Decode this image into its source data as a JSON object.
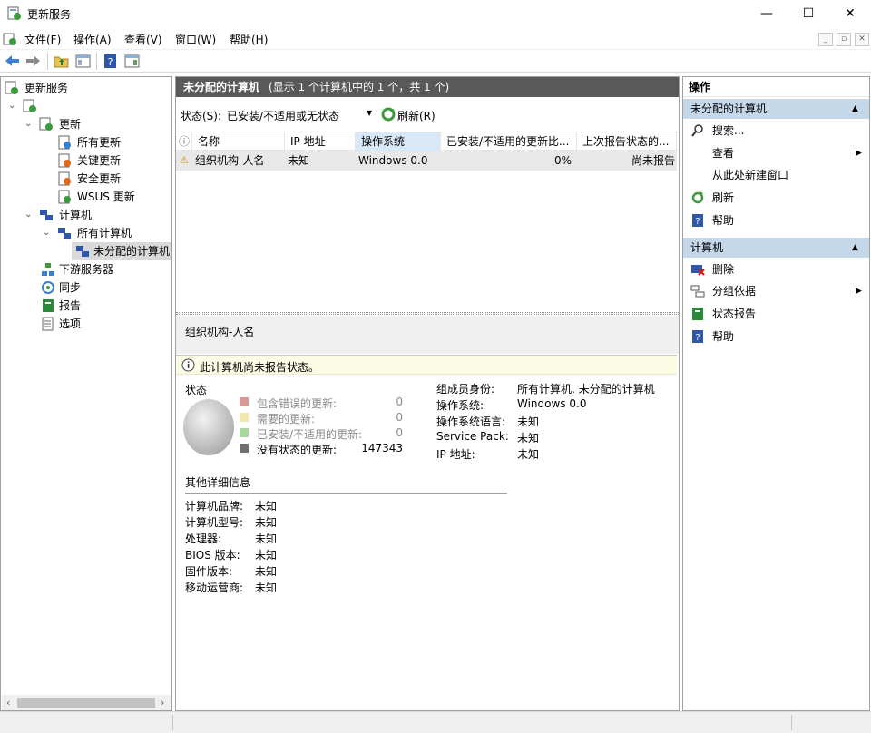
{
  "window": {
    "title": "更新服务",
    "minimize": "—",
    "maximize": "☐",
    "close": "✕"
  },
  "menu": [
    "文件(F)",
    "操作(A)",
    "查看(V)",
    "窗口(W)",
    "帮助(H)"
  ],
  "mdi": {
    "min": "_",
    "restore": "▫",
    "close": "✕"
  },
  "tree": {
    "root": "更新服务",
    "updates": "更新",
    "all_updates": "所有更新",
    "critical_updates": "关键更新",
    "security_updates": "安全更新",
    "wsus_updates": "WSUS 更新",
    "computers": "计算机",
    "all_computers": "所有计算机",
    "unassigned": "未分配的计算机",
    "downstream": "下游服务器",
    "sync": "同步",
    "reports": "报告",
    "options": "选项"
  },
  "middle": {
    "header": "未分配的计算机",
    "header_sub": "(显示 1 个计算机中的 1 个，共 1 个)",
    "filter_label": "状态(S):",
    "filter_value": "已安装/不适用或无状态",
    "refresh": "刷新(R)",
    "columns": [
      "名称",
      "IP 地址",
      "操作系统",
      "已安装/不适用的更新比...",
      "上次报告状态的..."
    ],
    "row": {
      "name": "组织机构-人名",
      "ip": "未知",
      "os": "Windows 0.0",
      "percent": "0%",
      "last_report": "尚未报告"
    },
    "detail_title": "组织机构-人名",
    "notice": "此计算机尚未报告状态。",
    "status_heading": "状态",
    "legend": [
      {
        "label": "包含错误的更新:",
        "value": "0",
        "color": "#d99795"
      },
      {
        "label": "需要的更新:",
        "value": "0",
        "color": "#f4e6b0"
      },
      {
        "label": "已安装/不适用的更新:",
        "value": "0",
        "color": "#a8d8a0"
      },
      {
        "label": "没有状态的更新:",
        "value": "147343",
        "color": "#707070"
      }
    ],
    "props": [
      {
        "k": "组成员身份:",
        "v": "所有计算机, 未分配的计算机"
      },
      {
        "k": "操作系统:",
        "v": "Windows 0.0"
      },
      {
        "k": "操作系统语言:",
        "v": "未知"
      },
      {
        "k": "Service Pack:",
        "v": "未知"
      },
      {
        "k": "IP 地址:",
        "v": "未知"
      }
    ],
    "other_heading": "其他详细信息",
    "other": [
      {
        "k": "计算机品牌:",
        "v": "未知"
      },
      {
        "k": "计算机型号:",
        "v": "未知"
      },
      {
        "k": "处理器:",
        "v": "未知"
      },
      {
        "k": "BIOS 版本:",
        "v": "未知"
      },
      {
        "k": "固件版本:",
        "v": "未知"
      },
      {
        "k": "移动运营商:",
        "v": "未知"
      }
    ]
  },
  "actions": {
    "title": "操作",
    "section1": "未分配的计算机",
    "search": "搜索...",
    "view": "查看",
    "new_window": "从此处新建窗口",
    "refresh": "刷新",
    "help1": "帮助",
    "section2": "计算机",
    "delete": "删除",
    "group_by": "分组依据",
    "status_report": "状态报告",
    "help2": "帮助"
  }
}
